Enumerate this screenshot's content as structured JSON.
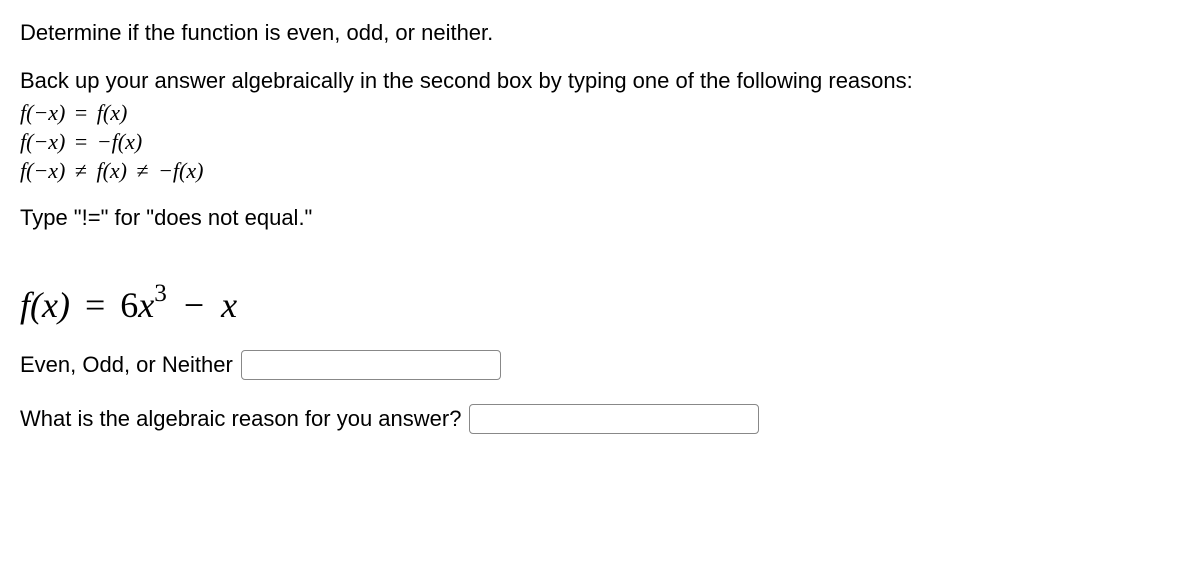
{
  "instructions": {
    "line1": "Determine if the function is even, odd, or neither.",
    "line2": "Back up your answer algebraically in the second box by typing one of the following reasons:",
    "typeHint": "Type \"!=\" for \"does not equal.\""
  },
  "reasons": {
    "even_lhs": "f(−x)",
    "even_op": "=",
    "even_rhs": "f(x)",
    "odd_lhs": "f(−x)",
    "odd_op": "=",
    "odd_rhs": "−f(x)",
    "neither_lhs": "f(−x)",
    "neither_op1": "≠",
    "neither_mid": "f(x)",
    "neither_op2": "≠",
    "neither_rhs": "−f(x)"
  },
  "formula": {
    "lhs": "f(x)",
    "eq": "=",
    "coef": "6",
    "var": "x",
    "exp": "3",
    "minus": "−",
    "term2": "x"
  },
  "questions": {
    "q1": "Even, Odd, or Neither",
    "q2": "What is the algebraic reason for you answer?"
  },
  "inputs": {
    "a1": "",
    "a2": ""
  }
}
